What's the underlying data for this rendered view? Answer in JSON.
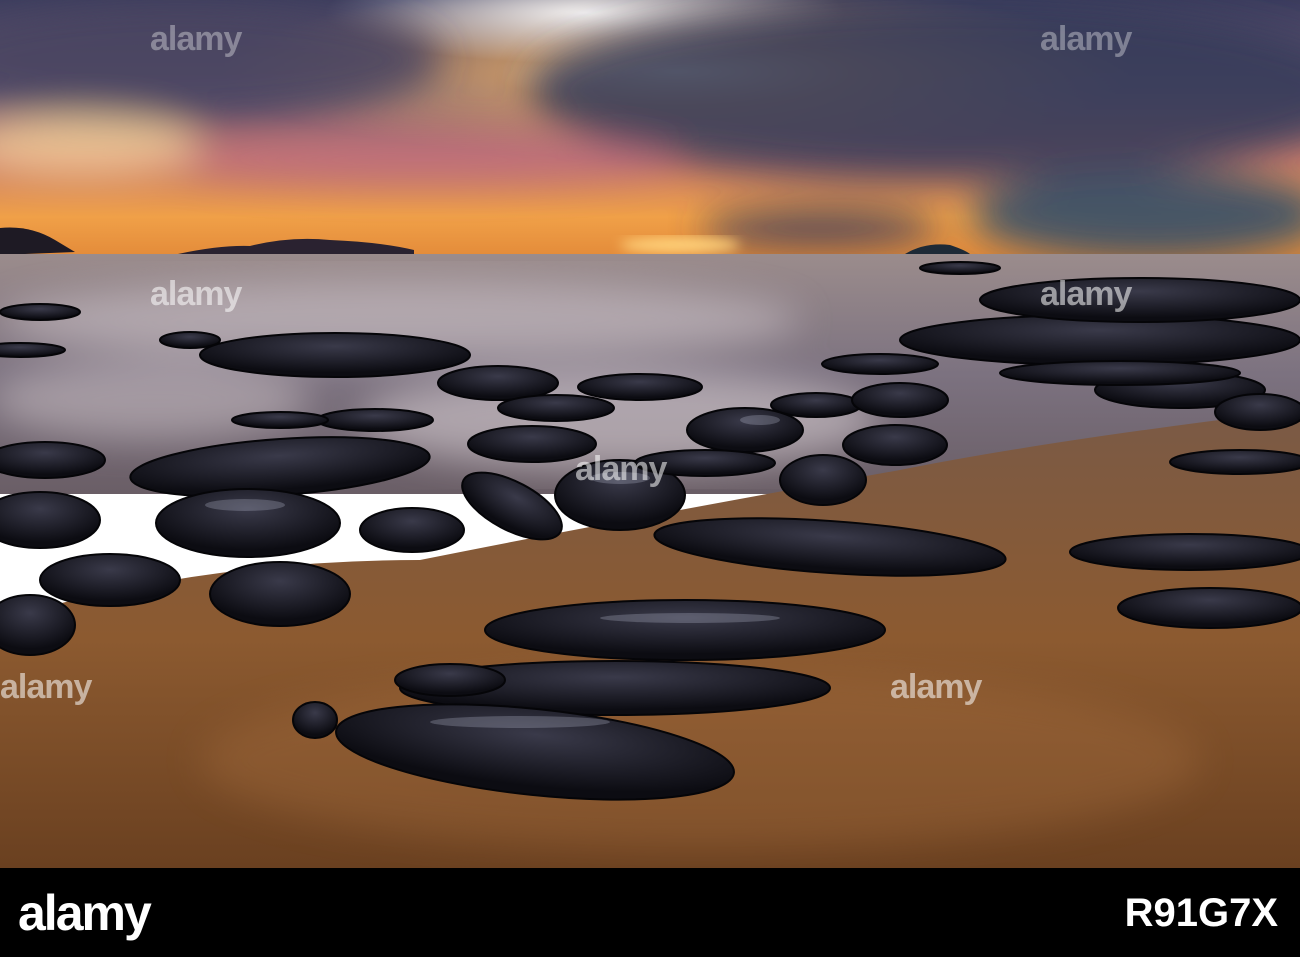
{
  "photo": {
    "subject": "",
    "colors": {
      "sky_top": "#4a4a6e",
      "sky_glow": "#f4a44a",
      "sun": "#ffd27a",
      "sea": "#8a7f8a",
      "sand": "#8a5a32",
      "rock": "#14141c",
      "cloud_dark": "#2e3550",
      "cloud_pink": "#b86a84"
    }
  },
  "watermark": {
    "text": "alamy"
  },
  "footer": {
    "brand": "alamy",
    "source_line": "",
    "image_id": "R91G7X",
    "background": "#000000"
  }
}
